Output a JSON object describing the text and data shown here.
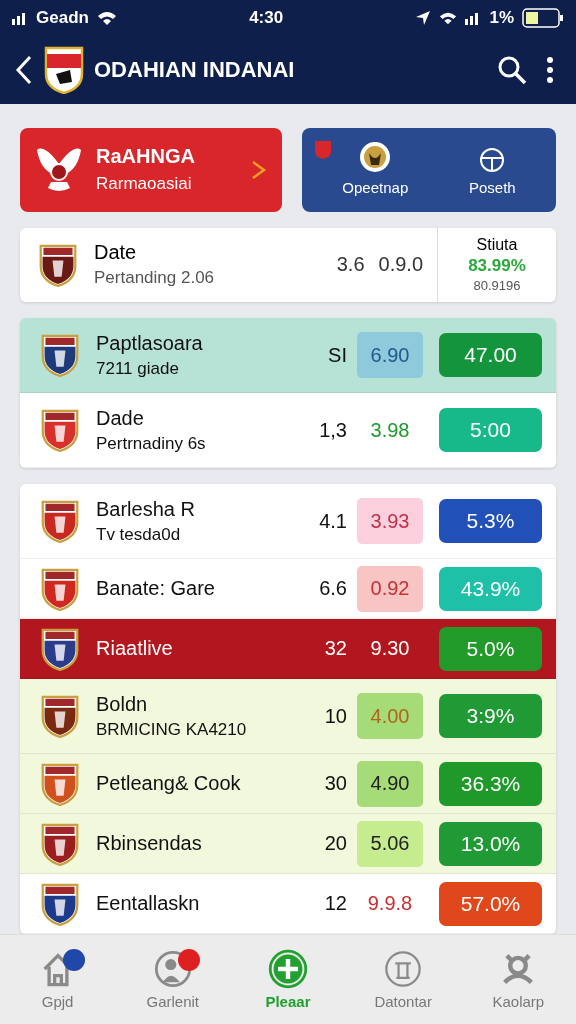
{
  "status_bar": {
    "carrier": "Geadn",
    "time": "4:30",
    "battery": "1%"
  },
  "header": {
    "title": "ODAHIAN INDANAI"
  },
  "promo": {
    "title": "RaAHNGA",
    "subtitle": "Rarmaoasiai",
    "links": [
      {
        "label": "Opeetnap"
      },
      {
        "label": "Poseth"
      }
    ]
  },
  "summary": {
    "title": "Date",
    "subtitle": "Pertanding 2.06",
    "values": [
      "3.6",
      "0.9.0"
    ],
    "side_title": "Stiuta",
    "side_value": "83.99%",
    "side_note": "80.9196"
  },
  "groups": [
    {
      "rows": [
        {
          "name": "Paptlasoara",
          "subtitle": "7211 giade",
          "num": "SI",
          "kind": "normal",
          "color": "#b7e2d6",
          "crest": {
            "color": "#1e3a7a"
          },
          "odds": {
            "text": "6.90",
            "kind": "navy",
            "color": "#8ec9dc"
          },
          "pct": {
            "text": "47.00",
            "color": "#14953c"
          }
        },
        {
          "name": "Dade",
          "subtitle": "Pertrnadiny 6s",
          "num": "1,3",
          "kind": "normal",
          "color": "#ffffff",
          "crest": {
            "color": "#d8302a"
          },
          "odds": {
            "text": "3.98",
            "kind": "green"
          },
          "pct": {
            "text": "5:00",
            "color": "#17b98a"
          }
        }
      ]
    },
    {
      "rows": [
        {
          "name": "Barlesha R",
          "subtitle": "Tv tesda0d",
          "num": "4.1",
          "kind": "normal",
          "color": "#ffffff",
          "crest": {
            "color": "#c8281e"
          },
          "odds": {
            "text": "3.93",
            "kind": "crimson",
            "color": "#fbd0dc"
          },
          "pct": {
            "text": "5.3%",
            "color": "#2150b8"
          }
        },
        {
          "name": "Banate: Gare",
          "num": "6.6",
          "kind": "normal",
          "color": "#ffffff",
          "crest": {
            "color": "#d0281e"
          },
          "odds": {
            "text": "0.92",
            "kind": "red",
            "color": "#f8c4c4"
          },
          "pct": {
            "text": "43.9%",
            "color": "#1fc0a8"
          }
        },
        {
          "name": "Riaatlive",
          "num": "32",
          "kind": "inverse",
          "color": "#b2161e",
          "crest": {
            "color": "#2a3c8a"
          },
          "odds": {
            "text": "9.30",
            "kind": "light"
          },
          "pct": {
            "text": "5.0%",
            "color": "#229a2a"
          }
        },
        {
          "name": "Boldn",
          "subtitle": "BRMICING KA4210",
          "num": "10",
          "kind": "normal",
          "color": "#f2f8dc",
          "crest": {
            "color": "#7a2a10"
          },
          "odds": {
            "text": "4.00",
            "kind": "amber",
            "color": "#a6dc78"
          },
          "pct": {
            "text": "3:9%",
            "color": "#1f9a34"
          }
        },
        {
          "name": "Petleang& Cook",
          "num": "30",
          "kind": "normal",
          "color": "#f2f8dc",
          "crest": {
            "color": "#d0501e"
          },
          "odds": {
            "text": "4.90",
            "kind": "dark",
            "color": "#a6dc78"
          },
          "pct": {
            "text": "36.3%",
            "color": "#1f9a2a"
          }
        },
        {
          "name": "Rbinsendas",
          "num": "20",
          "kind": "normal",
          "color": "#f2f8dc",
          "crest": {
            "color": "#9a1e1e"
          },
          "odds": {
            "text": "5.06",
            "kind": "dark",
            "color": "#c6ec90"
          },
          "pct": {
            "text": "13.0%",
            "color": "#1f9a34"
          }
        },
        {
          "name": "Eentallaskn",
          "num": "12",
          "kind": "normal",
          "color": "#ffffff",
          "crest": {
            "color": "#1e3a8a"
          },
          "odds": {
            "text": "9.9.8",
            "kind": "red"
          },
          "pct": {
            "text": "57.0%",
            "color": "#e0481c"
          }
        }
      ]
    }
  ],
  "nav": [
    {
      "label": "Gpjd",
      "kind": "house",
      "selected": false,
      "badge": {
        "color": "#1f48a8"
      }
    },
    {
      "label": "Garlenit",
      "kind": "person",
      "selected": false,
      "badge": {
        "color": "#e02020"
      }
    },
    {
      "label": "Pleaar",
      "kind": "plus",
      "selected": true
    },
    {
      "label": "Datontar",
      "kind": "pillar",
      "selected": false
    },
    {
      "label": "Kaolarp",
      "kind": "figure",
      "selected": false
    }
  ]
}
